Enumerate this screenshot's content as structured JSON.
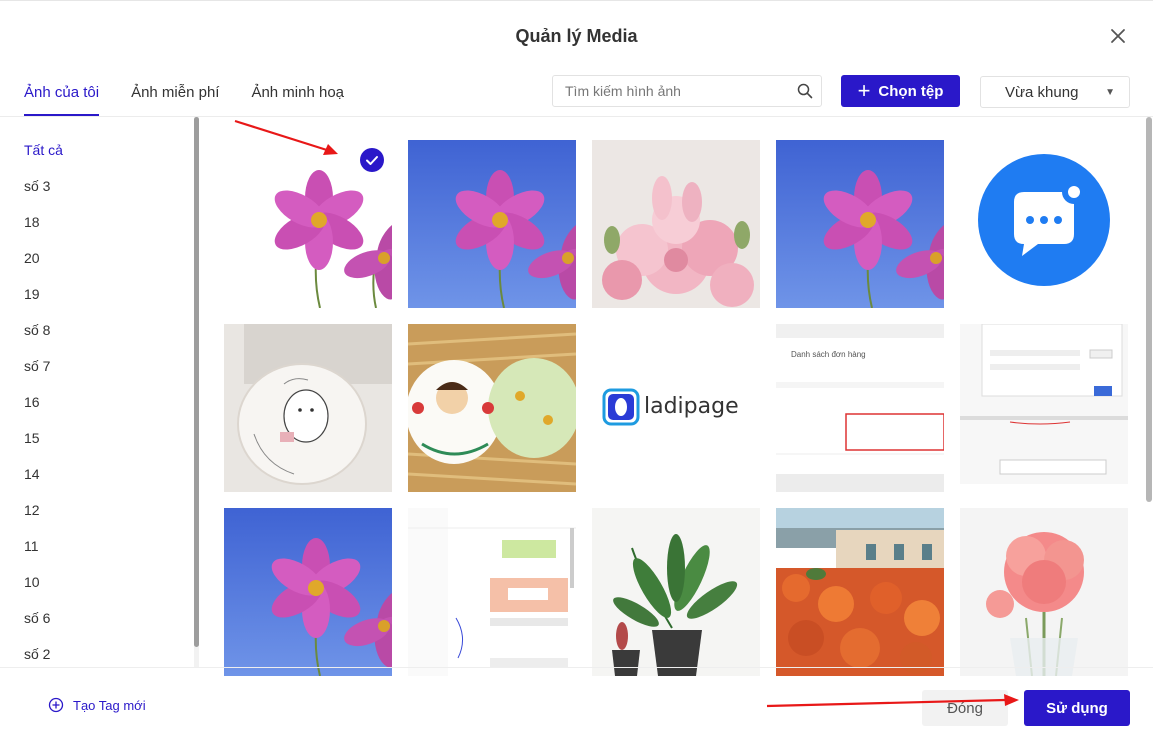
{
  "modal": {
    "title": "Quản lý Media"
  },
  "tabs": [
    {
      "label": "Ảnh của tôi",
      "active": true
    },
    {
      "label": "Ảnh miễn phí",
      "active": false
    },
    {
      "label": "Ảnh minh hoạ",
      "active": false
    }
  ],
  "search": {
    "placeholder": "Tìm kiếm hình ảnh",
    "value": ""
  },
  "toolbar": {
    "choose_file_label": "Chọn tệp",
    "fit_select_value": "Vừa khung"
  },
  "sidebar": {
    "items": [
      {
        "label": "Tất cả",
        "active": true
      },
      {
        "label": "số 3"
      },
      {
        "label": "18"
      },
      {
        "label": "20"
      },
      {
        "label": "19"
      },
      {
        "label": "số 8"
      },
      {
        "label": "số 7"
      },
      {
        "label": "16"
      },
      {
        "label": "15"
      },
      {
        "label": "14"
      },
      {
        "label": "12"
      },
      {
        "label": "11"
      },
      {
        "label": "10"
      },
      {
        "label": "số 6"
      },
      {
        "label": "số 2"
      }
    ],
    "new_tag_label": "Tạo Tag mới"
  },
  "images": [
    {
      "kind": "cosmos-flower-white",
      "selected": true
    },
    {
      "kind": "cosmos-flower-blue-sky"
    },
    {
      "kind": "pink-rose-bouquet"
    },
    {
      "kind": "cosmos-flower-blue-sky"
    },
    {
      "kind": "chat-app-logo"
    },
    {
      "kind": "birthday-cake-cat"
    },
    {
      "kind": "birthday-cakes-pair"
    },
    {
      "kind": "ladipage-logo",
      "text": "ladipage"
    },
    {
      "kind": "order-list-screenshot",
      "text": "Danh sách đơn hàng"
    },
    {
      "kind": "dialog-screenshot"
    },
    {
      "kind": "cosmos-flower-blue-sky"
    },
    {
      "kind": "editor-screenshot"
    },
    {
      "kind": "potted-plant"
    },
    {
      "kind": "orange-flower-garden"
    },
    {
      "kind": "pink-peony-vase"
    }
  ],
  "footer": {
    "close_label": "Đóng",
    "use_label": "Sử dụng"
  },
  "colors": {
    "accent": "#2a18c9",
    "annotation_arrow": "#e81818"
  }
}
